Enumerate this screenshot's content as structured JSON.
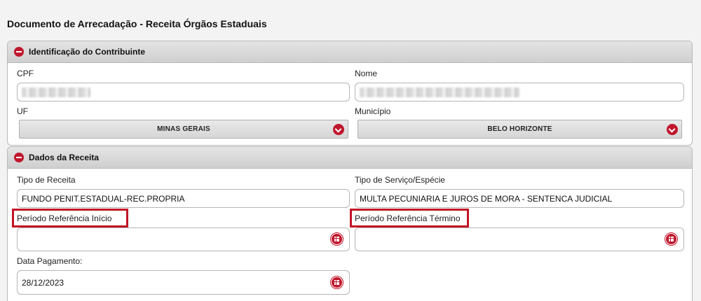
{
  "page": {
    "title": "Documento de Arrecadação - Receita Órgãos Estaduais"
  },
  "colors": {
    "accent": "#c0172d",
    "highlight": "#c21426",
    "header_bg": "#d8d8d8"
  },
  "contribuinte": {
    "title": "Identificação do Contribuinte",
    "cpf_label": "CPF",
    "nome_label": "Nome",
    "uf_label": "UF",
    "uf_value": "MINAS GERAIS",
    "municipio_label": "Município",
    "municipio_value": "BELO HORIZONTE"
  },
  "receita": {
    "title": "Dados da Receita",
    "tipo_receita_label": "Tipo de Receita",
    "tipo_receita_value": "FUNDO PENIT.ESTADUAL-REC.PROPRIA",
    "tipo_servico_label": "Tipo de Serviço/Espécie",
    "tipo_servico_value": "MULTA PECUNIARIA E JUROS DE MORA - SENTENCA JUDICIAL",
    "periodo_inicio_label": "Período Referência Início",
    "periodo_inicio_value": "",
    "periodo_termino_label": "Período Referência Término",
    "periodo_termino_value": "",
    "data_pagamento_label": "Data Pagamento:",
    "data_pagamento_value": "28/12/2023"
  },
  "icons": {
    "collapse": "minus-circle-icon",
    "dropdown": "chevron-down-icon",
    "calendar": "calendar-icon"
  }
}
